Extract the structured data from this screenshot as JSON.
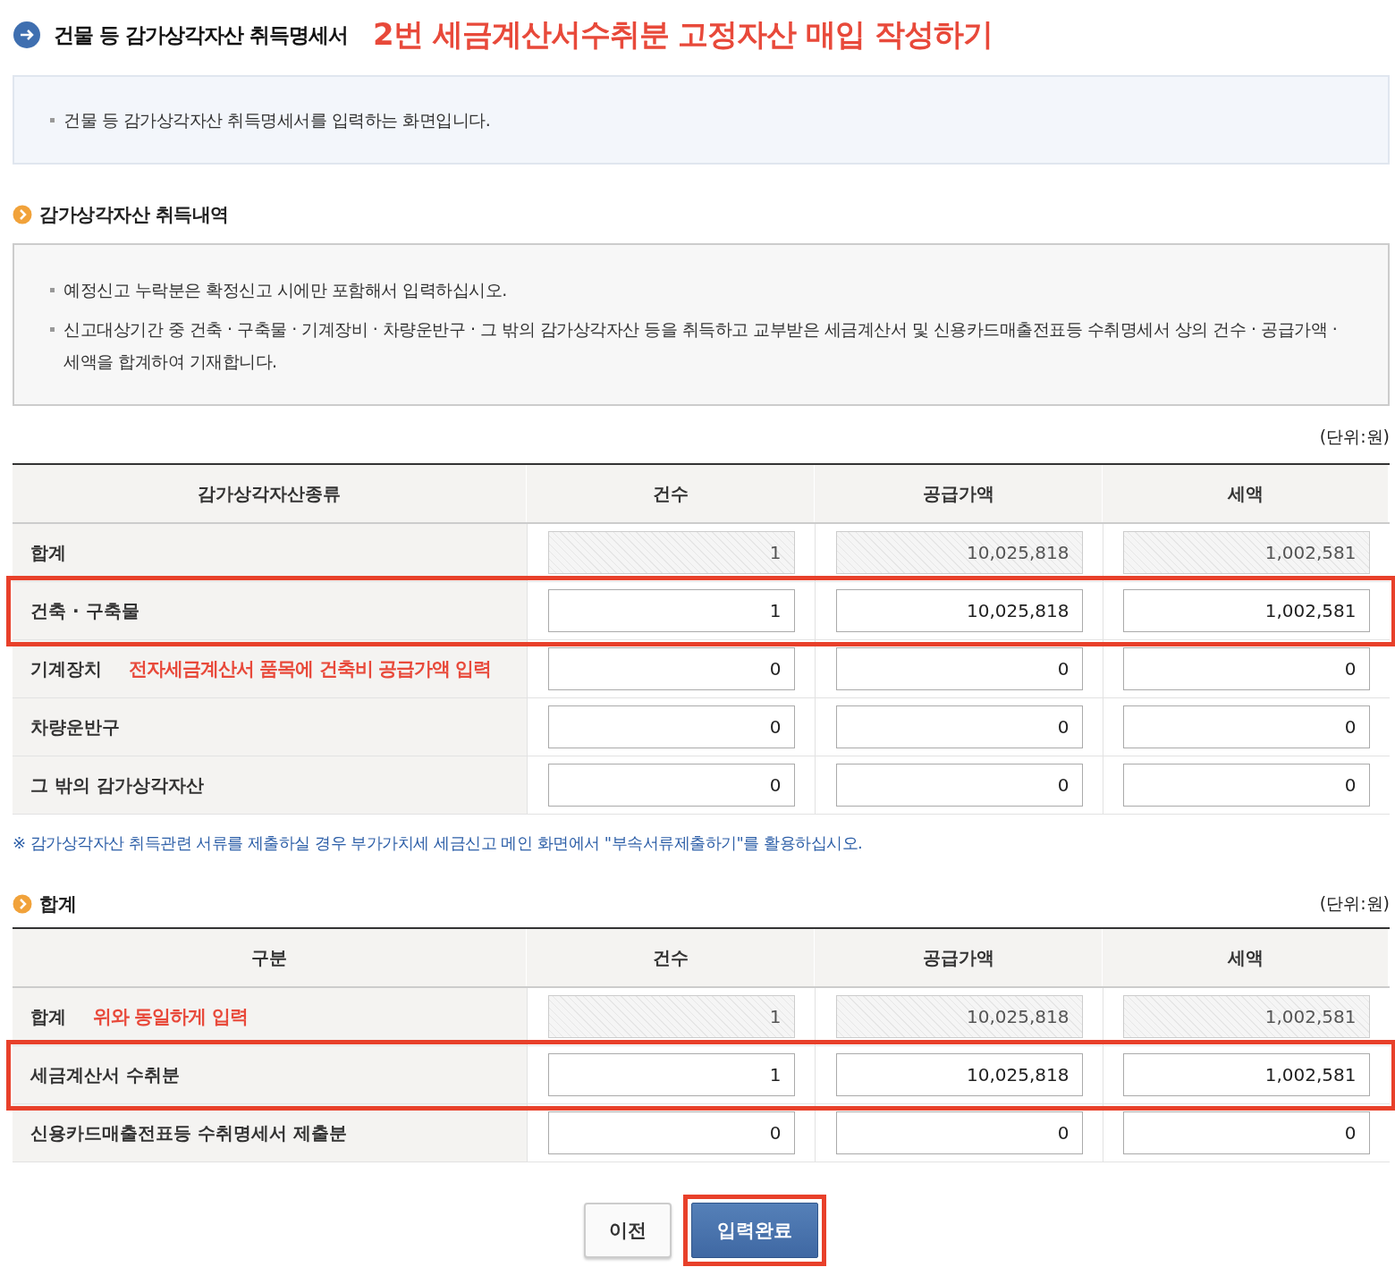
{
  "header": {
    "title": "건물 등 감가상각자산 취득명세서",
    "annotation": "2번 세금계산서수취분 고정자산 매입 작성하기"
  },
  "intro": {
    "bullets": [
      "건물 등 감가상각자산 취득명세서를 입력하는 화면입니다."
    ]
  },
  "acquisition": {
    "title": "감가상각자산 취득내역",
    "notes": [
      "예정신고 누락분은 확정신고 시에만 포함해서 입력하십시오.",
      "신고대상기간 중 건축 · 구축물 · 기계장비 · 차량운반구 · 그 밖의 감가상각자산 등을 취득하고 교부받은 세금계산서 및 신용카드매출전표등 수취명세서 상의 건수 · 공급가액 · 세액을 합계하여 기재합니다."
    ],
    "unit": "(단위:원)",
    "columns": [
      "감가상각자산종류",
      "건수",
      "공급가액",
      "세액"
    ],
    "rows": [
      {
        "label": "합계",
        "values": [
          "1",
          "10,025,818",
          "1,002,581"
        ],
        "readonly": true,
        "highlighted": false
      },
      {
        "label": "건축 · 구축물",
        "values": [
          "1",
          "10,025,818",
          "1,002,581"
        ],
        "readonly": false,
        "highlighted": true
      },
      {
        "label": "기계장치",
        "annotation": "전자세금계산서 품목에 건축비 공급가액 입력",
        "values": [
          "0",
          "0",
          "0"
        ],
        "readonly": false,
        "highlighted": false
      },
      {
        "label": "차량운반구",
        "values": [
          "0",
          "0",
          "0"
        ],
        "readonly": false,
        "highlighted": false
      },
      {
        "label": "그 밖의 감가상각자산",
        "values": [
          "0",
          "0",
          "0"
        ],
        "readonly": false,
        "highlighted": false
      }
    ]
  },
  "footnote": "※ 감가상각자산 취득관련 서류를 제출하실 경우 부가가치세 세금신고 메인 화면에서 \"부속서류제출하기\"를 활용하십시오.",
  "summary": {
    "title": "합계",
    "unit": "(단위:원)",
    "columns": [
      "구분",
      "건수",
      "공급가액",
      "세액"
    ],
    "rows": [
      {
        "label": "합계",
        "annotation": "위와 동일하게 입력",
        "values": [
          "1",
          "10,025,818",
          "1,002,581"
        ],
        "readonly": true,
        "highlighted": false
      },
      {
        "label": "세금계산서 수취분",
        "values": [
          "1",
          "10,025,818",
          "1,002,581"
        ],
        "readonly": false,
        "highlighted": true
      },
      {
        "label": "신용카드매출전표등 수취명세서 제출분",
        "values": [
          "0",
          "0",
          "0"
        ],
        "readonly": false,
        "highlighted": false
      }
    ]
  },
  "buttons": [
    {
      "label": "이전",
      "kind": "secondary",
      "highlighted": false
    },
    {
      "label": "입력완료",
      "kind": "primary",
      "highlighted": true
    }
  ]
}
